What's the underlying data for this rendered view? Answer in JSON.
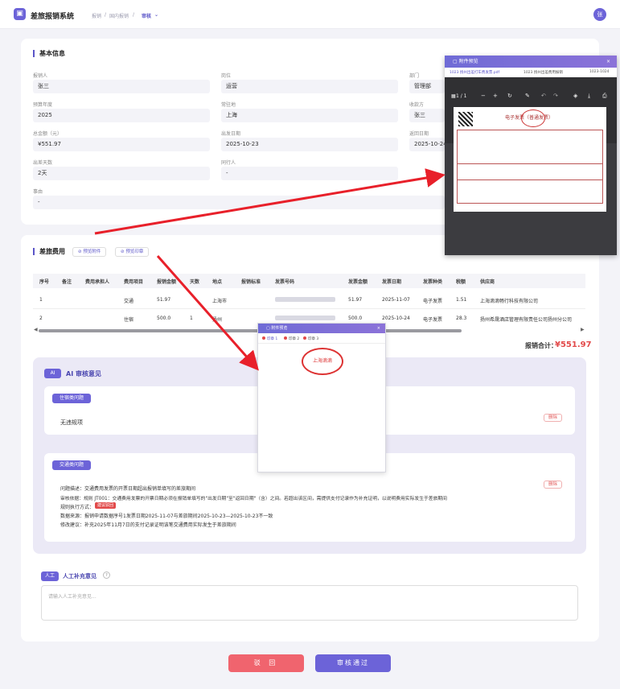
{
  "header": {
    "logo_glyph": "▣",
    "app_title": "差旅报销系统",
    "breadcrumb": [
      "报销",
      "/",
      "国内报销",
      "/",
      "审核"
    ],
    "breadcrumb_chevron": "⌄",
    "avatar": "张"
  },
  "basic_info": {
    "title": "基本信息",
    "fields": [
      {
        "label": "报销人",
        "value": "张三"
      },
      {
        "label": "岗位",
        "value": "运营"
      },
      {
        "label": "部门",
        "value": "管理部"
      },
      {
        "label": "预算年度",
        "value": "2025"
      },
      {
        "label": "常驻地",
        "value": "上海"
      },
      {
        "label": "收款方",
        "value": "张三"
      },
      {
        "label": "总金额（元）",
        "value": "¥551.97"
      },
      {
        "label": "出发日期",
        "value": "2025-10-23"
      },
      {
        "label": "返回日期",
        "value": "2025-10-24"
      },
      {
        "label": "出差天数",
        "value": "2天"
      },
      {
        "label": "同行人",
        "value": "-"
      },
      {
        "label": "事由",
        "value": "-"
      }
    ]
  },
  "expenses": {
    "title": "差旅费用",
    "btn_attachment": "预览附件",
    "btn_seal": "预览印章",
    "columns": [
      "序号",
      "备注",
      "费用承担人",
      "费用项目",
      "报销金额",
      "天数",
      "地点",
      "报销标准",
      "发票号码",
      "发票金额",
      "发票日期",
      "发票种类",
      "税额",
      "供应商"
    ],
    "rows": [
      {
        "no": "1",
        "item": "交通",
        "amount": "51.97",
        "days": "",
        "place": "上海市",
        "inv_amount": "51.97",
        "inv_date": "2025-11-07",
        "inv_type": "电子发票",
        "tax": "1.51",
        "supplier": "上海滴滴畅行科技有限公司"
      },
      {
        "no": "2",
        "item": "住宿",
        "amount": "500.0",
        "days": "1",
        "place": "扬州",
        "inv_amount": "500.0",
        "inv_date": "2025-10-24",
        "inv_type": "电子发票",
        "tax": "28.3",
        "supplier": "扬州希晟酒店管理有限责任公司扬州分公司"
      }
    ],
    "total_label": "报销合计：",
    "total_value": "¥551.97"
  },
  "ai_review": {
    "badge": "AI",
    "title": "AI 审核意见",
    "lodging": {
      "tag": "住宿类问题",
      "text": "无违规项",
      "delete": "删除"
    },
    "transport": {
      "tag": "交通类问题",
      "delete": "删除",
      "lines": [
        "问题描述：交通费用发票的开票日期超出报销单填写的差旅期间",
        "审核依据：规则 JT001：交通费用发票的开票日期必须在报销单填写的\"出发日期\"至\"返回日期\"（含）之间。若超出该区间，需提供支付记录作为补充证明，以说明费用实际发生于差旅期间",
        "规则执行方式：",
        "数据来源：报销申请数据序号1发票日期2025-11-07与差旅期间2025-10-23—2025-10-23不一致",
        "修改建议：补充2025年11月7日的支付记录证明该笔交通费用实际发生于差旅期间"
      ],
      "exec_badge": "建议驳回"
    }
  },
  "manual": {
    "badge": "人工",
    "title": "人工补充意见",
    "help": "?",
    "placeholder": "请输入人工补充意见..."
  },
  "actions": {
    "reject": "驳 回",
    "approve": "审核通过"
  },
  "attachment_panel": {
    "title": "附件预览",
    "close": "×",
    "tabs": [
      "1023 扬州出差打车费发票.pdf",
      "1023 扬州出差费用报销",
      "1023-1024"
    ],
    "page": "1 / 1",
    "doc_title": "电子发票（普通发票）"
  },
  "seal_popup": {
    "title": "附件预览",
    "close": "×",
    "tabs": [
      "印章 1",
      "印章 2",
      "印章 3"
    ],
    "seal_text": "上海滴滴"
  },
  "colors": {
    "accent": "#6c63d8",
    "danger": "#e24a4a",
    "arrow": "#e8202a"
  }
}
